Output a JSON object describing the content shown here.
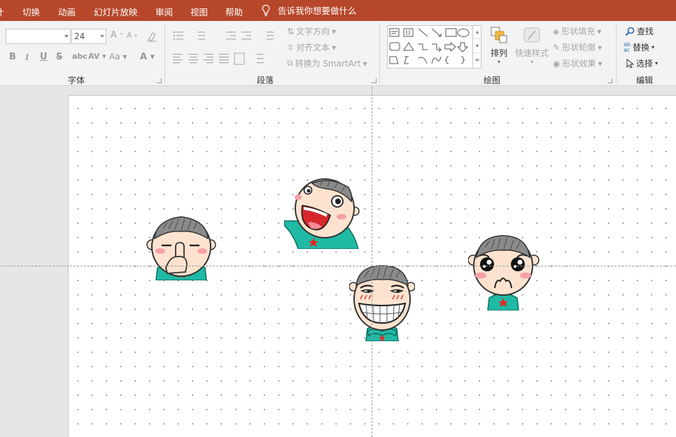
{
  "tabs": [
    {
      "label": "计",
      "active": false
    },
    {
      "label": "切换",
      "active": false
    },
    {
      "label": "动画",
      "active": false
    },
    {
      "label": "幻灯片放映",
      "active": false
    },
    {
      "label": "审阅",
      "active": false
    },
    {
      "label": "视图",
      "active": false
    },
    {
      "label": "帮助",
      "active": false
    }
  ],
  "tell_me": "告诉我你想要做什么",
  "font_group": {
    "label": "字体",
    "font_name": "",
    "font_size": "24"
  },
  "paragraph_group": {
    "label": "段落",
    "text_direction": "文字方向",
    "align_text": "对齐文本",
    "convert_smartart": "转换为 SmartArt"
  },
  "drawing_group": {
    "label": "绘图",
    "arrange": "排列",
    "quick_styles": "快速样式",
    "shape_fill": "形状填充",
    "shape_outline": "形状轮廓",
    "shape_effects": "形状效果"
  },
  "editing_group": {
    "label": "编辑",
    "find": "查找",
    "replace": "替换",
    "select": "选择"
  },
  "colors": {
    "tab_bar": "#b7472a",
    "ribbon": "#f3f3f3",
    "shirt": "#1fb9a4",
    "star": "#e8231a"
  },
  "stickers": [
    {
      "name": "shushing-boy-sticker"
    },
    {
      "name": "laughing-boy-sticker"
    },
    {
      "name": "smirking-boy-sticker"
    },
    {
      "name": "teary-boy-sticker"
    }
  ]
}
